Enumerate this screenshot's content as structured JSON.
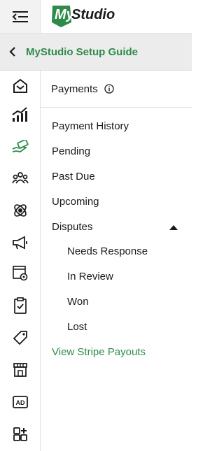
{
  "header": {
    "menu_icon": "collapse-menu-icon",
    "logo_text": "MyStudio",
    "logo_color": "#2e8b49"
  },
  "guide": {
    "back_icon": "chevron-left-icon",
    "title": "MyStudio Setup Guide"
  },
  "rail": {
    "active_item": "payments",
    "accent_color": "#2e8b49",
    "icons": [
      "home-icon",
      "analytics-icon",
      "payments-icon",
      "members-icon",
      "billing-icon",
      "marketing-icon",
      "web-settings-icon",
      "checklist-icon",
      "tag-icon",
      "store-icon",
      "ad-icon",
      "add-apps-icon"
    ],
    "ad_label": "AD"
  },
  "panel": {
    "title": "Payments",
    "info_icon": "info-icon",
    "items": [
      {
        "label": "Payment History"
      },
      {
        "label": "Pending"
      },
      {
        "label": "Past Due"
      },
      {
        "label": "Upcoming"
      },
      {
        "label": "Disputes",
        "expanded": true
      }
    ],
    "dispute_items": [
      {
        "label": "Needs Response"
      },
      {
        "label": "In Review"
      },
      {
        "label": "Won"
      },
      {
        "label": "Lost"
      }
    ],
    "stripe_link": "View Stripe Payouts"
  }
}
